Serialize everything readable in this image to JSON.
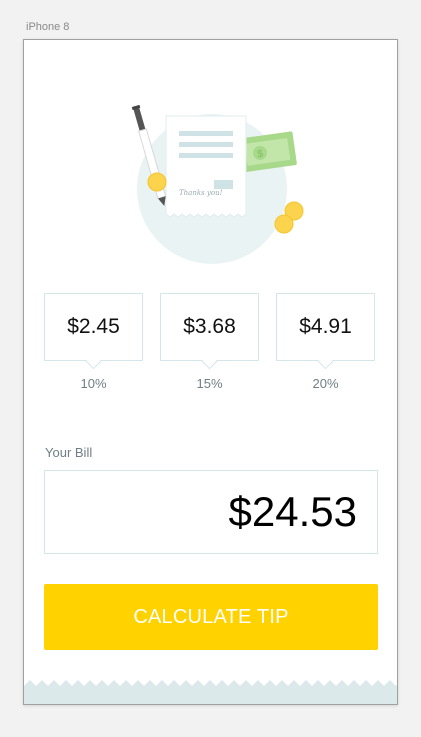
{
  "device": {
    "label": "iPhone 8"
  },
  "illustration": {
    "note_text": "Thanks you!"
  },
  "tips": [
    {
      "amount": "$2.45",
      "percent": "10%"
    },
    {
      "amount": "$3.68",
      "percent": "15%"
    },
    {
      "amount": "$4.91",
      "percent": "20%"
    }
  ],
  "bill": {
    "label": "Your Bill",
    "value": "$24.53"
  },
  "button": {
    "label": "CALCULATE TIP"
  },
  "colors": {
    "accent": "#ffd200",
    "card_border": "#d5e6e8",
    "muted_text": "#6f7f84",
    "footer": "#dbe9ea"
  }
}
